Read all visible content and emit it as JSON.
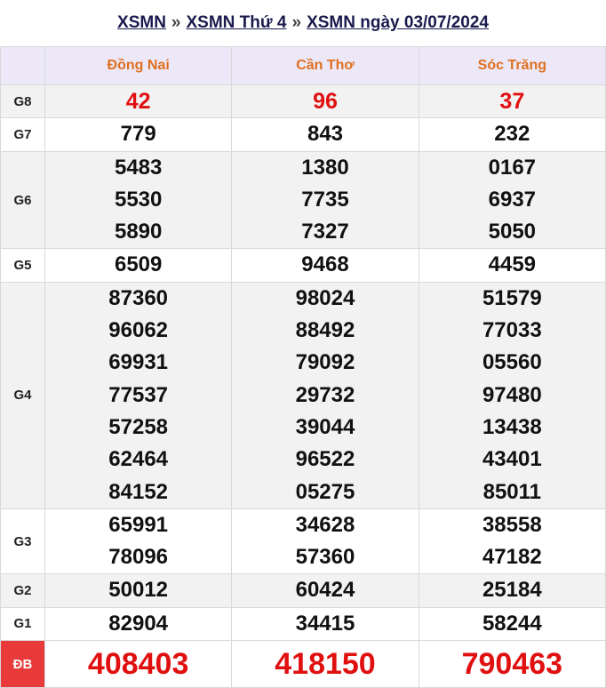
{
  "breadcrumb": {
    "items": [
      "XSMN",
      "XSMN Thứ 4",
      "XSMN ngày 03/07/2024"
    ],
    "separator": "»"
  },
  "columns": [
    "Đồng Nai",
    "Cần Thơ",
    "Sóc Trăng"
  ],
  "prizes": {
    "g8": {
      "label": "G8",
      "values": [
        [
          "42"
        ],
        [
          "96"
        ],
        [
          "37"
        ]
      ]
    },
    "g7": {
      "label": "G7",
      "values": [
        [
          "779"
        ],
        [
          "843"
        ],
        [
          "232"
        ]
      ]
    },
    "g6": {
      "label": "G6",
      "values": [
        [
          "5483",
          "5530",
          "5890"
        ],
        [
          "1380",
          "7735",
          "7327"
        ],
        [
          "0167",
          "6937",
          "5050"
        ]
      ]
    },
    "g5": {
      "label": "G5",
      "values": [
        [
          "6509"
        ],
        [
          "9468"
        ],
        [
          "4459"
        ]
      ]
    },
    "g4": {
      "label": "G4",
      "values": [
        [
          "87360",
          "96062",
          "69931",
          "77537",
          "57258",
          "62464",
          "84152"
        ],
        [
          "98024",
          "88492",
          "79092",
          "29732",
          "39044",
          "96522",
          "05275"
        ],
        [
          "51579",
          "77033",
          "05560",
          "97480",
          "13438",
          "43401",
          "85011"
        ]
      ]
    },
    "g3": {
      "label": "G3",
      "values": [
        [
          "65991",
          "78096"
        ],
        [
          "34628",
          "57360"
        ],
        [
          "38558",
          "47182"
        ]
      ]
    },
    "g2": {
      "label": "G2",
      "values": [
        [
          "50012"
        ],
        [
          "60424"
        ],
        [
          "25184"
        ]
      ]
    },
    "g1": {
      "label": "G1",
      "values": [
        [
          "82904"
        ],
        [
          "34415"
        ],
        [
          "58244"
        ]
      ]
    },
    "db": {
      "label": "ĐB",
      "values": [
        [
          "408403"
        ],
        [
          "418150"
        ],
        [
          "790463"
        ]
      ]
    }
  },
  "colors": {
    "header_bg": "#ece8f8",
    "header_text": "#e07020",
    "highlight_red": "#e01010",
    "special_prize_bg": "#e83a3a"
  }
}
